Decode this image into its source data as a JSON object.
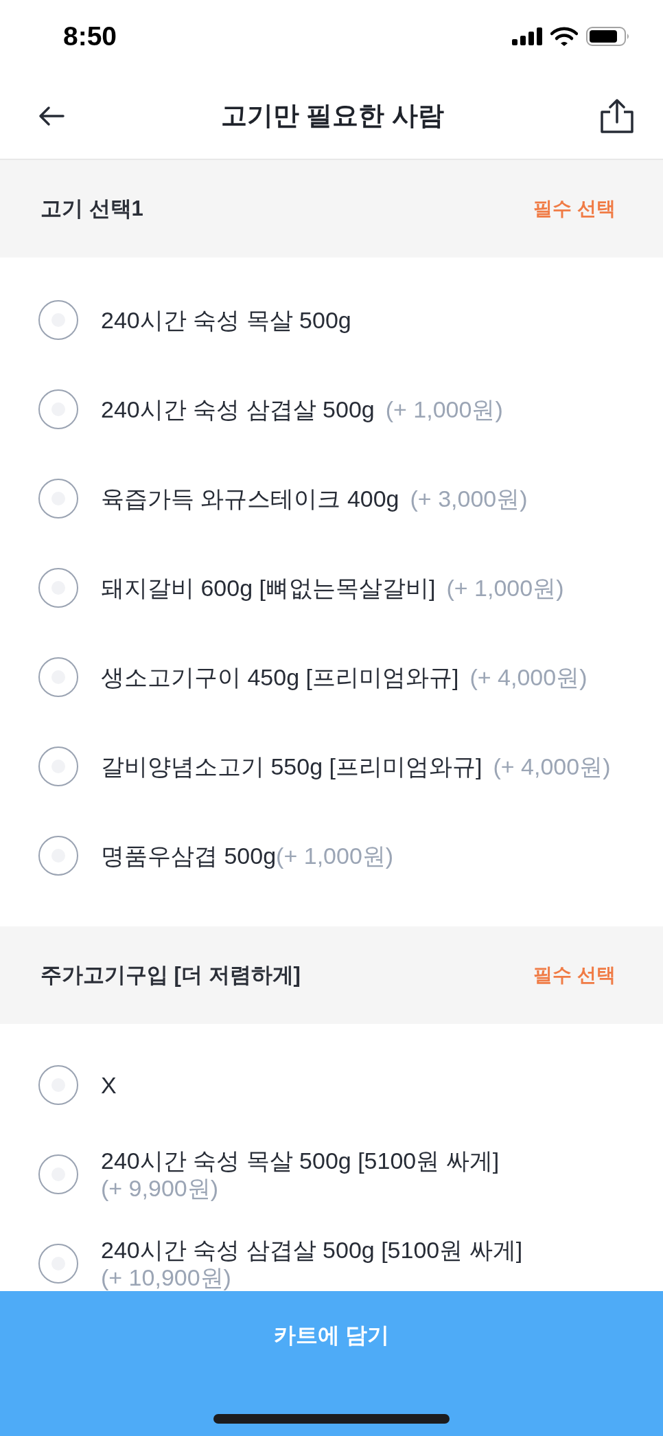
{
  "status_bar": {
    "time": "8:50"
  },
  "header": {
    "title": "고기만 필요한 사람"
  },
  "option_groups": [
    {
      "title": "고기 선택1",
      "badge": "필수 선택",
      "options": [
        {
          "kind": "plain",
          "label": "240시간 숙성 목살 500g",
          "selected": false
        },
        {
          "kind": "inline",
          "label": "240시간 숙성 삼겹살 500g",
          "price": "(+ 1,000원)",
          "selected": false
        },
        {
          "kind": "inline",
          "label": "육즙가득 와규스테이크 400g",
          "price": "(+ 3,000원)",
          "selected": false
        },
        {
          "kind": "inline",
          "label": "돼지갈비 600g [뼈없는목살갈비]",
          "price": "(+ 1,000원)",
          "selected": false
        },
        {
          "kind": "inline",
          "label": "생소고기구이 450g [프리미엄와규]",
          "price": "(+ 4,000원)",
          "selected": false
        },
        {
          "kind": "inline",
          "label": "갈비양념소고기 550g [프리미엄와규]",
          "price": "(+ 4,000원)",
          "selected": false
        },
        {
          "kind": "tight",
          "label": "명품우삼겹 500g",
          "price": "(+ 1,000원)",
          "selected": false
        }
      ]
    },
    {
      "title": "주가고기구입 [더 저렴하게]",
      "badge": "필수 선택",
      "options": [
        {
          "kind": "plain",
          "label": "X",
          "selected": false
        },
        {
          "kind": "stacked",
          "label": "240시간 숙성 목살 500g [5100원 싸게]",
          "price": "(+ 9,900원)",
          "selected": false
        },
        {
          "kind": "stacked",
          "label": "240시간 숙성 삼겹살 500g [5100원 싸게]",
          "price": "(+ 10,900원)",
          "selected": false
        }
      ]
    }
  ],
  "cart_button": {
    "label": "카트에 담기"
  }
}
